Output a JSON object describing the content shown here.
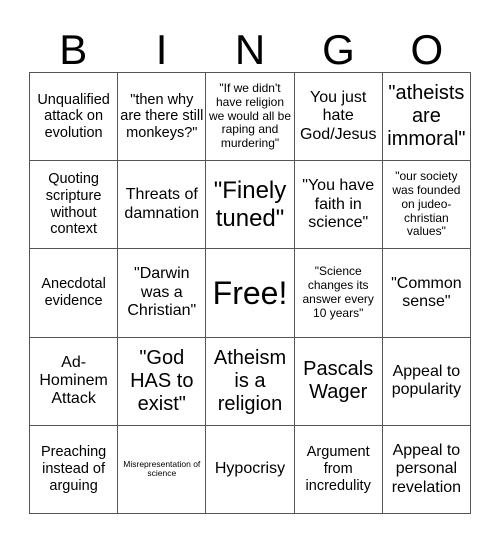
{
  "header": [
    "B",
    "I",
    "N",
    "G",
    "O"
  ],
  "cells": [
    {
      "text": "Unqualified attack on evolution",
      "size": "s14"
    },
    {
      "text": "\"then why are there still monkeys?\"",
      "size": "s14"
    },
    {
      "text": "\"If we didn't have religion we would all be raping and murdering\"",
      "size": "s11"
    },
    {
      "text": "You just hate God/Jesus",
      "size": "s16"
    },
    {
      "text": "\"atheists are immoral\"",
      "size": "s20"
    },
    {
      "text": "Quoting scripture without context",
      "size": "s14"
    },
    {
      "text": "Threats of damnation",
      "size": "s16"
    },
    {
      "text": "\"Finely tuned\"",
      "size": "s24"
    },
    {
      "text": "\"You have faith in science\"",
      "size": "s16"
    },
    {
      "text": "\"our society was founded on judeo-christian values\"",
      "size": "s11"
    },
    {
      "text": "Anecdotal evidence",
      "size": "s14"
    },
    {
      "text": "\"Darwin was a Christian\"",
      "size": "s16"
    },
    {
      "text": "Free!",
      "size": "s32"
    },
    {
      "text": "\"Science changes its answer every 10 years\"",
      "size": "s11"
    },
    {
      "text": "\"Common sense\"",
      "size": "s16"
    },
    {
      "text": "Ad-Hominem Attack",
      "size": "s16"
    },
    {
      "text": "\"God HAS to exist\"",
      "size": "s20"
    },
    {
      "text": "Atheism is a religion",
      "size": "s20"
    },
    {
      "text": "Pascals Wager",
      "size": "s20"
    },
    {
      "text": "Appeal to popularity",
      "size": "s16"
    },
    {
      "text": "Preaching instead of arguing",
      "size": "s14"
    },
    {
      "text": "Misrepresentation of science",
      "size": "s8"
    },
    {
      "text": "Hypocrisy",
      "size": "s16"
    },
    {
      "text": "Argument from incredulity",
      "size": "s14"
    },
    {
      "text": "Appeal to personal revelation",
      "size": "s16"
    }
  ]
}
